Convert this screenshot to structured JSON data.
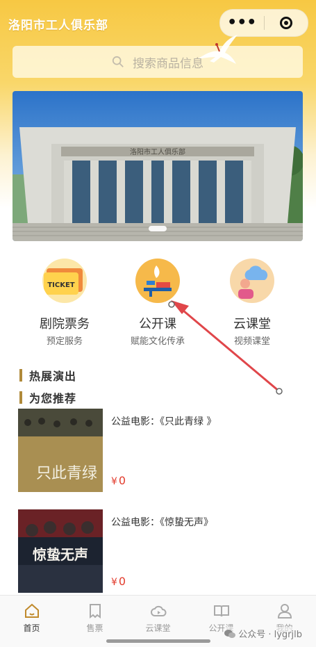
{
  "app": {
    "title": "洛阳市工人俱乐部"
  },
  "capsule": {
    "more": "•••"
  },
  "search": {
    "placeholder": "搜索商品信息"
  },
  "banner": {
    "building_sign": "洛阳市工人俱乐部"
  },
  "categories": [
    {
      "label": "剧院票务",
      "sub": "预定服务",
      "icon": "ticket-icon",
      "badge": "TICKET"
    },
    {
      "label": "公开课",
      "sub": "赋能文化传承",
      "icon": "lamp-book-icon"
    },
    {
      "label": "云课堂",
      "sub": "视频课堂",
      "icon": "cloud-class-icon"
    }
  ],
  "sections": {
    "hot": "热展演出",
    "recommend": "为您推荐"
  },
  "recommend_items": [
    {
      "title": "公益电影：《只此青绿 》",
      "price_symbol": "¥",
      "price": "0",
      "poster_text": "只此青绿"
    },
    {
      "title": "公益电影：《惊蛰无声》",
      "price_symbol": "¥",
      "price": "0",
      "poster_text": "惊蛰无声"
    }
  ],
  "tabbar": [
    {
      "label": "首页",
      "icon": "home-icon",
      "active": true
    },
    {
      "label": "售票",
      "icon": "ticket-tab-icon",
      "active": false
    },
    {
      "label": "云课堂",
      "icon": "cloud-icon",
      "active": false
    },
    {
      "label": "公开课",
      "icon": "book-icon",
      "active": false
    },
    {
      "label": "我的",
      "icon": "user-icon",
      "active": false
    }
  ],
  "watermark": {
    "text": "公众号 · lygrjlb"
  },
  "colors": {
    "header_gold": "#f7c843",
    "accent_brown": "#b08a3a",
    "price_red": "#e23b2c",
    "arrow_red": "#e0464a"
  }
}
